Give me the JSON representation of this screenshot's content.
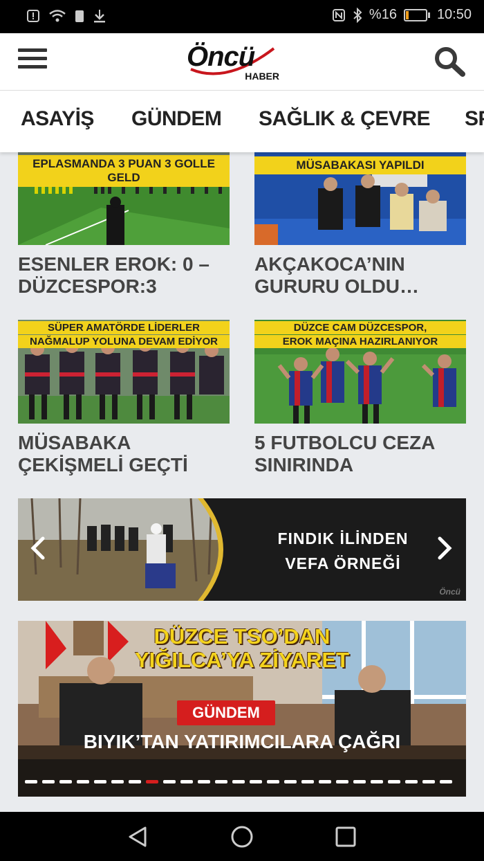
{
  "status_bar": {
    "battery_text": "%16",
    "battery_level": 0.16,
    "time": "10:50",
    "icons": [
      "alert-icon",
      "wifi-icon",
      "sim-icon",
      "download-icon",
      "nfc-icon",
      "bluetooth-icon",
      "battery-icon"
    ]
  },
  "header": {
    "logo_text": "Öncü",
    "logo_subtext": "HABER",
    "icons": [
      "menu-icon",
      "search-icon"
    ]
  },
  "tabs": [
    "ASAYİŞ",
    "GÜNDEM",
    "SAĞLIK & ÇEVRE",
    "SPOR"
  ],
  "news": [
    {
      "banner": "EPLASMANDA 3 PUAN 3 GOLLE GELD",
      "title_line1": "ESENLER EROK: 0 –",
      "title_line2": "DÜZCESPOR:3"
    },
    {
      "banner": "MÜSABAKASI YAPILDI",
      "title_line1": "AKÇAKOCA’NIN",
      "title_line2": "GURURU OLDU…"
    },
    {
      "banner": "SÜPER AMATÖRDE LİDERLER",
      "banner2": "NAĞMALUP YOLUNA DEVAM EDİYOR",
      "title_line1": "MÜSABAKA",
      "title_line2": "ÇEKİŞMELİ GEÇTİ"
    },
    {
      "banner": "DÜZCE CAM DÜZCESPOR,",
      "banner2": "EROK MAÇINA HAZIRLANIYOR",
      "title_line1": "5 FUTBOLCU CEZA",
      "title_line2": "SINIRINDA"
    }
  ],
  "slider": {
    "line1": "FINDIK İLİNDEN",
    "line2": "VEFA ÖRNEĞİ",
    "watermark": "Öncü"
  },
  "feature": {
    "headline_line1": "DÜZCE TSO’DAN",
    "headline_line2": "YIĞILCA’YA ZİYARET",
    "category_badge": "GÜNDEM",
    "title": "BIYIK’TAN YATIRIMCILARA ÇAĞRI",
    "pager_total": 25,
    "pager_active": 7
  },
  "colors": {
    "accent_red": "#d51e1e",
    "headline_yellow": "#f4d31c",
    "background": "#e9ebee"
  }
}
